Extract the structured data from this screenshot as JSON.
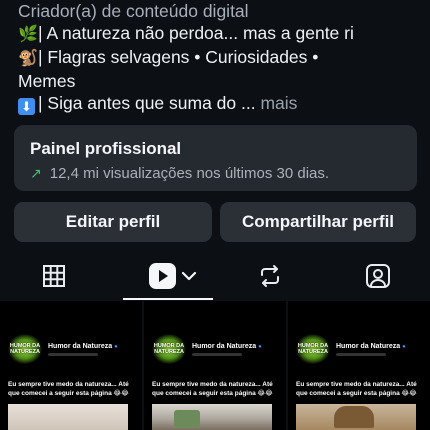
{
  "bio": {
    "category": "Criador(a) de conteúdo digital",
    "line1": "| A natureza não perdoa... mas a gente ri",
    "line2": "| Flagras selvagens • Curiosidades •",
    "line3": "Memes",
    "line4": "| Siga antes que suma do ...",
    "more": "mais",
    "emoji_leaf": "🌿",
    "emoji_monkey": "🐒",
    "emoji_arrow": "⬇"
  },
  "dashboard": {
    "title": "Painel profissional",
    "stats": "12,4 mi visualizações nos últimos 30 dias.",
    "trend_icon": "↗"
  },
  "buttons": {
    "edit": "Editar perfil",
    "share": "Compartilhar perfil"
  },
  "tabs": [
    "grid-icon",
    "reels-icon",
    "reposts-icon",
    "tagged-icon"
  ],
  "active_tab": "reels-icon",
  "posts": [
    {
      "logo_text": "HUMOR DA NATUREZA",
      "account": "Humor da Natureza",
      "caption": "Eu sempre tive medo da natureza... Até que comecei a seguir esta página 😂😂"
    },
    {
      "logo_text": "HUMOR DA NATUREZA",
      "account": "Humor da Natureza",
      "caption": "Eu sempre tive medo da natureza... Até que comecei a seguir esta página 😂😂"
    },
    {
      "logo_text": "HUMOR DA NATUREZA",
      "account": "Humor da Natureza",
      "caption": "Eu sempre tive medo da natureza... Até que comecei a seguir esta página 😂😂"
    }
  ],
  "colors": {
    "background": "#0c0f14",
    "card": "#252930",
    "button": "#2b2f36",
    "trend_green": "#3cc46f",
    "verified_blue": "#3d8ff0"
  }
}
